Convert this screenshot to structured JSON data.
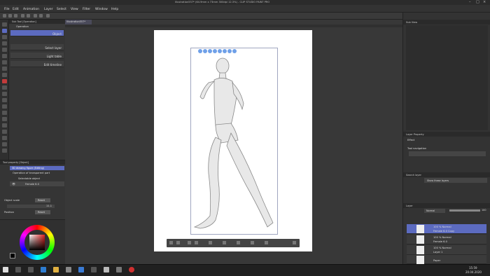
{
  "window": {
    "title": "Illustration557* (64.9mm x 73mm 300dpi 12.3%) - CLIP STUDIO PAINT PRO"
  },
  "menu": {
    "items": [
      "File",
      "Edit",
      "Animation",
      "Layer",
      "Select",
      "View",
      "Filter",
      "Window",
      "Help"
    ]
  },
  "subtool": {
    "header": "Sub Tool [Operation]",
    "group": "Operation",
    "items": [
      "Object",
      "Select layer",
      "Light table",
      "Edit timeline"
    ]
  },
  "tool_property": {
    "header": "Tool property [Object]",
    "name": "3D drawing figure (Editing)",
    "rows": [
      "Operation of transparent part",
      "Selectable object",
      "Female 6.0",
      "Object scale",
      "Position"
    ],
    "reset_label": "Reset",
    "scale_value": "11.1"
  },
  "colors": {
    "accent": "#5c6bc0",
    "frame": "#a0a6c0"
  },
  "document": {
    "tab": "Illustration557*"
  },
  "right_panel": {
    "sub_view": "Sub View",
    "layer_property": "Layer Property",
    "effect_label": "Effect",
    "tool_navigation": "Tool navigation",
    "search_layer": "Search layer",
    "show_these": "Show these layers",
    "layer_header": "Layer",
    "blend_mode": "Normal",
    "opacity": "100"
  },
  "layers": [
    {
      "line1": "100 % Normal",
      "line2": "Female 6.0 Copy",
      "selected": true
    },
    {
      "line1": "100 % Normal",
      "line2": "Female 6.0",
      "selected": false
    },
    {
      "line1": "100 % Normal",
      "line2": "Layer 1",
      "selected": false
    },
    {
      "line1": "",
      "line2": "Paper",
      "selected": false
    }
  ],
  "taskbar": {
    "time": "15:59",
    "date": "20.04.2020"
  }
}
